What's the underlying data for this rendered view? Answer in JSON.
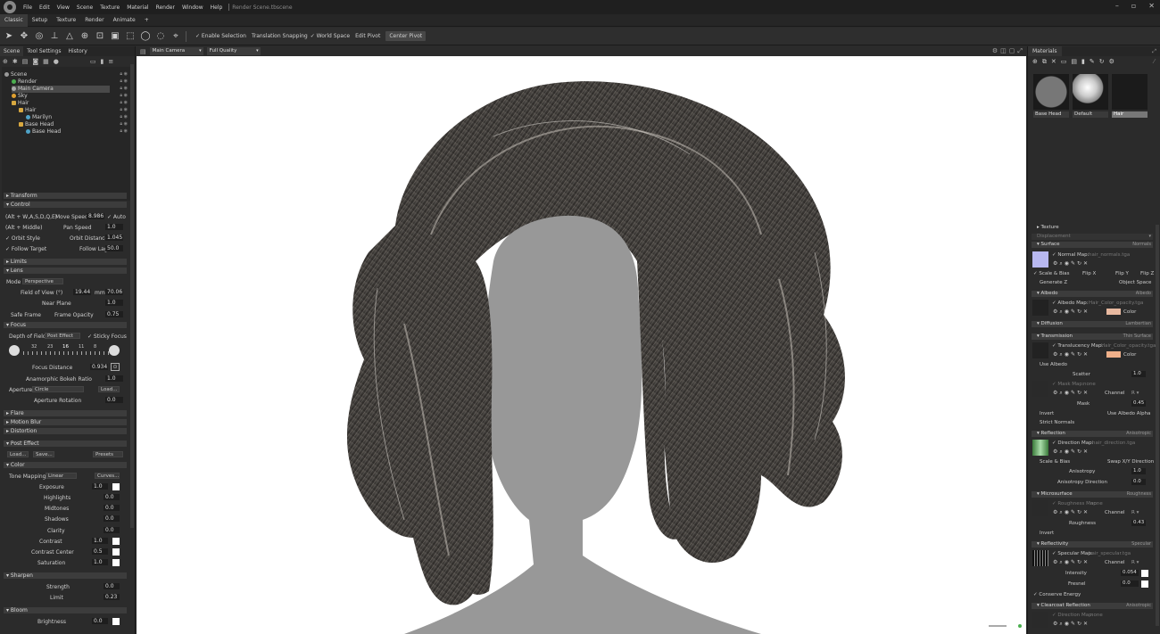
{
  "app": {
    "title": "Render Scene.tbscene"
  },
  "menu": [
    "File",
    "Edit",
    "View",
    "Scene",
    "Texture",
    "Material",
    "Render",
    "Window",
    "Help"
  ],
  "tabs": [
    "Classic",
    "Setup",
    "Texture",
    "Render",
    "Animate",
    "+"
  ],
  "toolbar": {
    "enable_selection": "✓ Enable Selection",
    "translation_snapping": "Translation Snapping",
    "world_space": "✓ World Space",
    "edit_pivot": "Edit Pivot",
    "center_pivot": "Center Pivot"
  },
  "left": {
    "tabs": [
      "Scene",
      "Tool Settings",
      "History"
    ],
    "tree": [
      "Scene",
      "Render",
      "Main Camera",
      "Sky",
      "Hair",
      "Hair",
      "Marilyn",
      "Base Head",
      "Base Head"
    ],
    "sections": {
      "transform": "Transform",
      "control": "Control",
      "limits": "Limits",
      "lens": "Lens",
      "focus": "Focus",
      "flare": "Flare",
      "motion_blur": "Motion Blur",
      "distortion": "Distortion",
      "post_effect": "Post Effect",
      "color": "Color",
      "sharpen": "Sharpen",
      "bloom": "Bloom"
    },
    "control": {
      "keys1": "(Alt + W,A,S,D,Q,E)",
      "move_speed_label": "Move Speed:",
      "move_speed": "8.986",
      "auto": "✓ Auto",
      "keys2": "(Alt + Middle)",
      "pan_speed_label": "Pan Speed",
      "pan_speed": "1.0",
      "orbit_style": "✓ Orbit Style",
      "orbit_distance_label": "Orbit Distance:",
      "orbit_distance": "1.045",
      "follow_target": "✓ Follow Target",
      "follow_lag_label": "Follow Lag",
      "follow_lag": "50.0"
    },
    "lens": {
      "mode_label": "Mode",
      "mode": "Perspective",
      "fov_label": "Field of View (°)",
      "fov": "19.44",
      "mm_label": "mm:",
      "mm": "70.06",
      "near_label": "Near Plane",
      "near": "1.0",
      "safe_frame": "Safe Frame",
      "frame_opacity_label": "Frame Opacity",
      "frame_opacity": "0.75"
    },
    "focus": {
      "dof_label": "Depth of Field",
      "dof": "Post Effect",
      "sticky": "✓ Sticky Focus",
      "fstops": [
        "32",
        "23",
        "16",
        "11",
        "8"
      ],
      "focus_distance_label": "Focus Distance",
      "focus_distance": "0.934",
      "anamorphic_label": "Anamorphic Bokeh Ratio",
      "anamorphic": "1.0",
      "aperture_label": "Aperture",
      "aperture": "Circle",
      "load": "Load...",
      "aperture_rotation_label": "Aperture Rotation",
      "aperture_rotation": "0.0"
    },
    "post": {
      "load": "Load...",
      "save": "Save...",
      "presets": "Presets"
    },
    "color": {
      "tone_label": "Tone Mapping",
      "tone": "Linear",
      "curves": "Curves...",
      "rows": [
        {
          "label": "Exposure",
          "value": "1.0"
        },
        {
          "label": "Highlights",
          "value": "0.0"
        },
        {
          "label": "Midtones",
          "value": "0.0"
        },
        {
          "label": "Shadows",
          "value": "0.0"
        },
        {
          "label": "Clarity",
          "value": "0.0"
        },
        {
          "label": "Contrast",
          "value": "1.0"
        },
        {
          "label": "Contrast Center",
          "value": "0.5"
        },
        {
          "label": "Saturation",
          "value": "1.0"
        }
      ]
    },
    "sharpen": {
      "strength_label": "Strength",
      "strength": "0.0",
      "limit_label": "Limit",
      "limit": "0.23"
    },
    "bloom": {
      "brightness_label": "Brightness",
      "brightness": "0.0"
    }
  },
  "viewport": {
    "camera": "Main Camera",
    "quality": "Full Quality"
  },
  "right": {
    "tab": "Materials",
    "materials": [
      "Base Head",
      "Default",
      "Hair"
    ],
    "texture": "Texture",
    "displacement": "Displacement",
    "surface": {
      "title": "Surface",
      "type": "Normals",
      "normal_map": "✓ Normal Map:",
      "normal_file": "hair_normals.tga",
      "scale_bias": "✓ Scale & Bias",
      "flipx": "Flip X",
      "flipy": "Flip Y",
      "flipz": "Flip Z",
      "genz": "Generate Z",
      "objspace": "Object Space"
    },
    "albedo": {
      "title": "Albedo",
      "type": "Albedo",
      "map": "✓ Albedo Map:",
      "file": "Hair_Color_opacity.tga",
      "color": "Color"
    },
    "diffusion": {
      "title": "Diffusion",
      "type": "Lambertian"
    },
    "transmission": {
      "title": "Transmission",
      "type": "Thin Surface",
      "map": "✓ Translucency Map:",
      "file": "Hair_Color_opacity.tga",
      "color": "Color",
      "use_albedo": "Use Albedo",
      "scatter_label": "Scatter",
      "scatter": "1.0",
      "mask_map": "✓ Mask Map:",
      "mask_file": "none",
      "channel": "Channel",
      "mask_label": "Mask",
      "mask": "0.45",
      "invert": "Invert",
      "use_albedo_alpha": "Use Albedo Alpha",
      "strict": "Strict Normals"
    },
    "reflection": {
      "title": "Reflection",
      "type": "Anisotropic",
      "map": "✓ Direction Map:",
      "file": "hair_direction.tga",
      "scale_bias": "Scale & Bias",
      "swap": "Swap X/Y Direction",
      "aniso_label": "Anisotropy",
      "aniso": "1.0",
      "aniso_dir_label": "Anisotropy Direction",
      "aniso_dir": "0.0"
    },
    "microsurface": {
      "title": "Microsurface",
      "type": "Roughness",
      "map": "✓ Roughness Map:",
      "file": "none",
      "channel": "Channel",
      "rough_label": "Roughness",
      "rough": "0.43",
      "invert": "Invert"
    },
    "reflectivity": {
      "title": "Reflectivity",
      "type": "Specular",
      "map": "✓ Specular Map:",
      "file": "hair_specular.tga",
      "channel": "Channel",
      "intensity_label": "Intensity",
      "intensity": "0.054",
      "fresnel_label": "Fresnel",
      "fresnel": "0.0",
      "conserve": "✓ Conserve Energy"
    },
    "clearcoat": {
      "title": "Clearcoat Reflection",
      "type": "Anisotropic",
      "map": "✓ Direction Map:",
      "file": "none"
    }
  },
  "colors": {
    "albedo_swatch": "#e8b9a0",
    "translucency_swatch": "#f0b08a",
    "normal_swatch": "#b8b8f0"
  }
}
